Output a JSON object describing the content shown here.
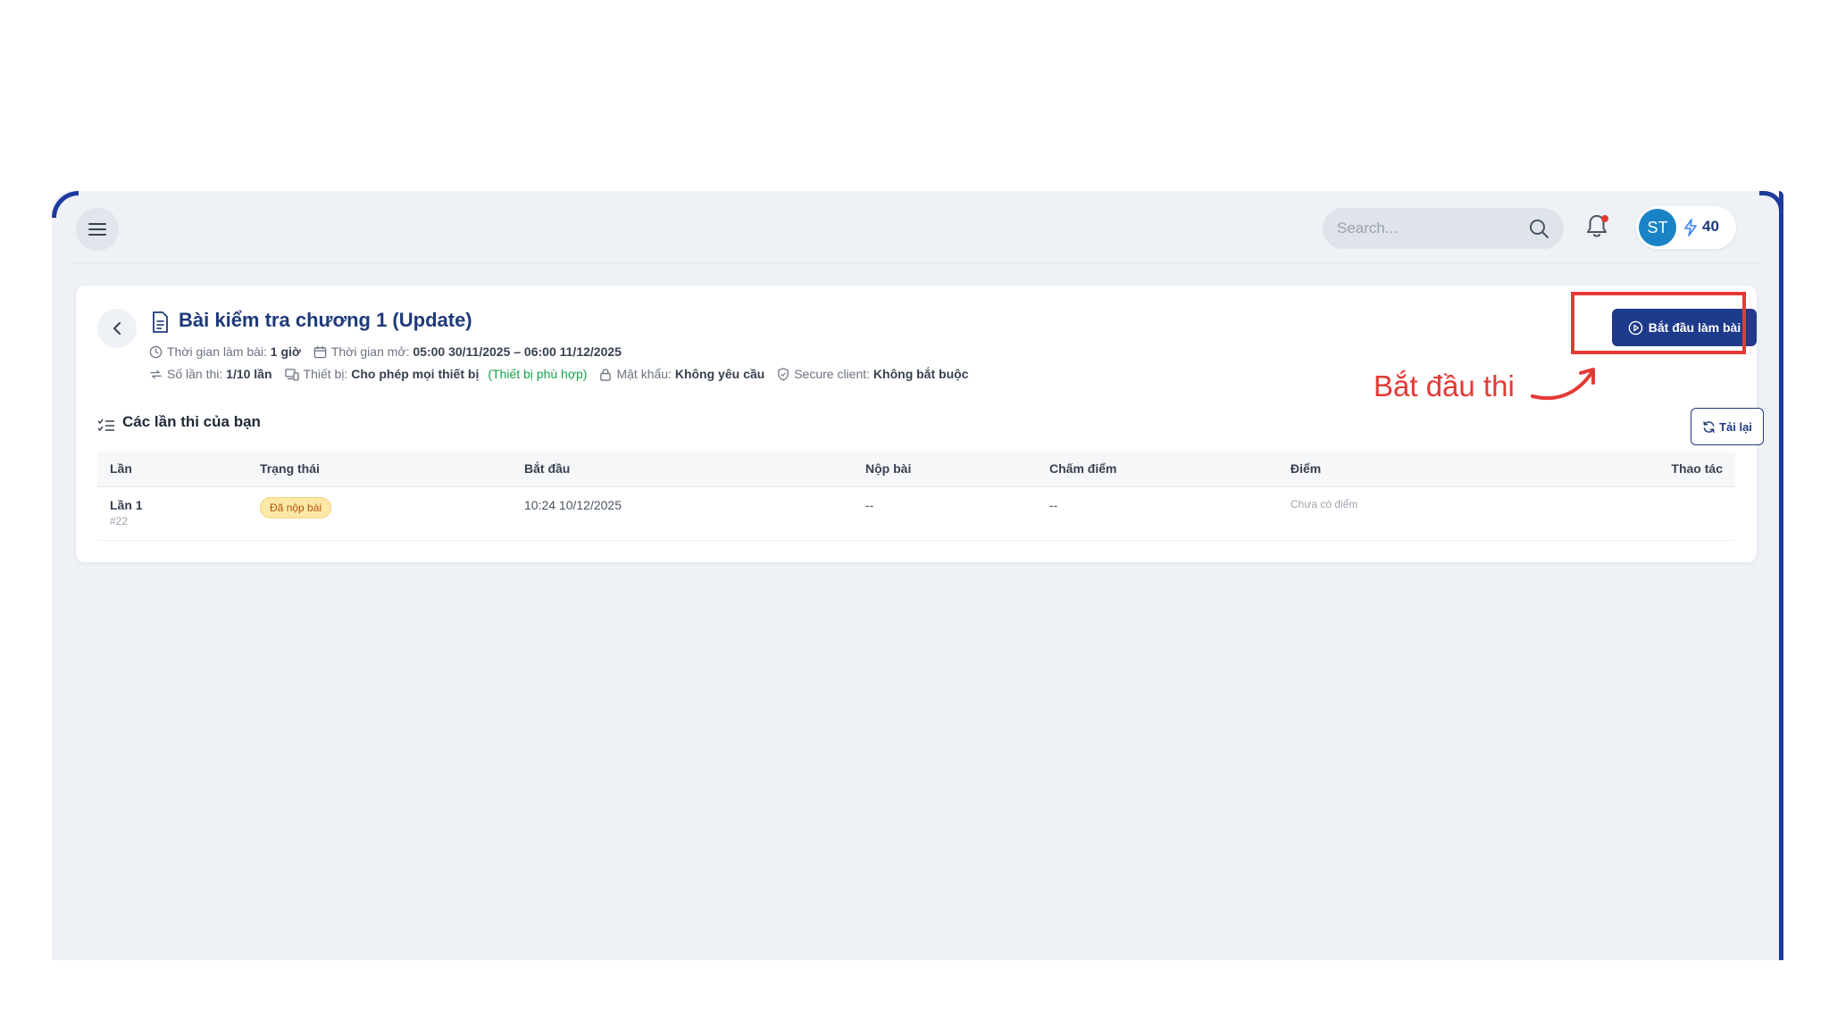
{
  "topbar": {
    "search_placeholder": "Search...",
    "avatar_initials": "ST",
    "points": "40",
    "notification_dot_color": "#e53935"
  },
  "exam": {
    "title": "Bài kiểm tra chương 1 (Update)",
    "duration_label": "Thời gian làm bài:",
    "duration_value": "1 giờ",
    "open_time_label": "Thời gian mở:",
    "open_time_value": "05:00 30/11/2025 – 06:00 11/12/2025",
    "attempts_label": "Số lần thi:",
    "attempts_value": "1/10 lần",
    "device_label": "Thiết bị:",
    "device_value": "Cho phép mọi thiết bị",
    "device_status": "(Thiết bị phù hợp)",
    "password_label": "Mật khẩu:",
    "password_value": "Không yêu cầu",
    "secure_label": "Secure client:",
    "secure_value": "Không bắt buộc",
    "start_button": "Bắt đầu làm bài"
  },
  "attempts_section": {
    "title": "Các lần thi của bạn",
    "reload_button": "Tải lại",
    "columns": [
      "Lần",
      "Trạng thái",
      "Bắt đầu",
      "Nộp bài",
      "Chấm điểm",
      "Điểm",
      "Thao tác"
    ],
    "rows": [
      {
        "attempt": "Lần 1",
        "attempt_id": "#22",
        "status": "Đã nộp bài",
        "started": "10:24 10/12/2025",
        "submitted": "--",
        "graded": "--",
        "score": "Chưa có điểm"
      }
    ]
  },
  "annotation": {
    "text": "Bắt đầu thi",
    "color": "#e53935"
  }
}
